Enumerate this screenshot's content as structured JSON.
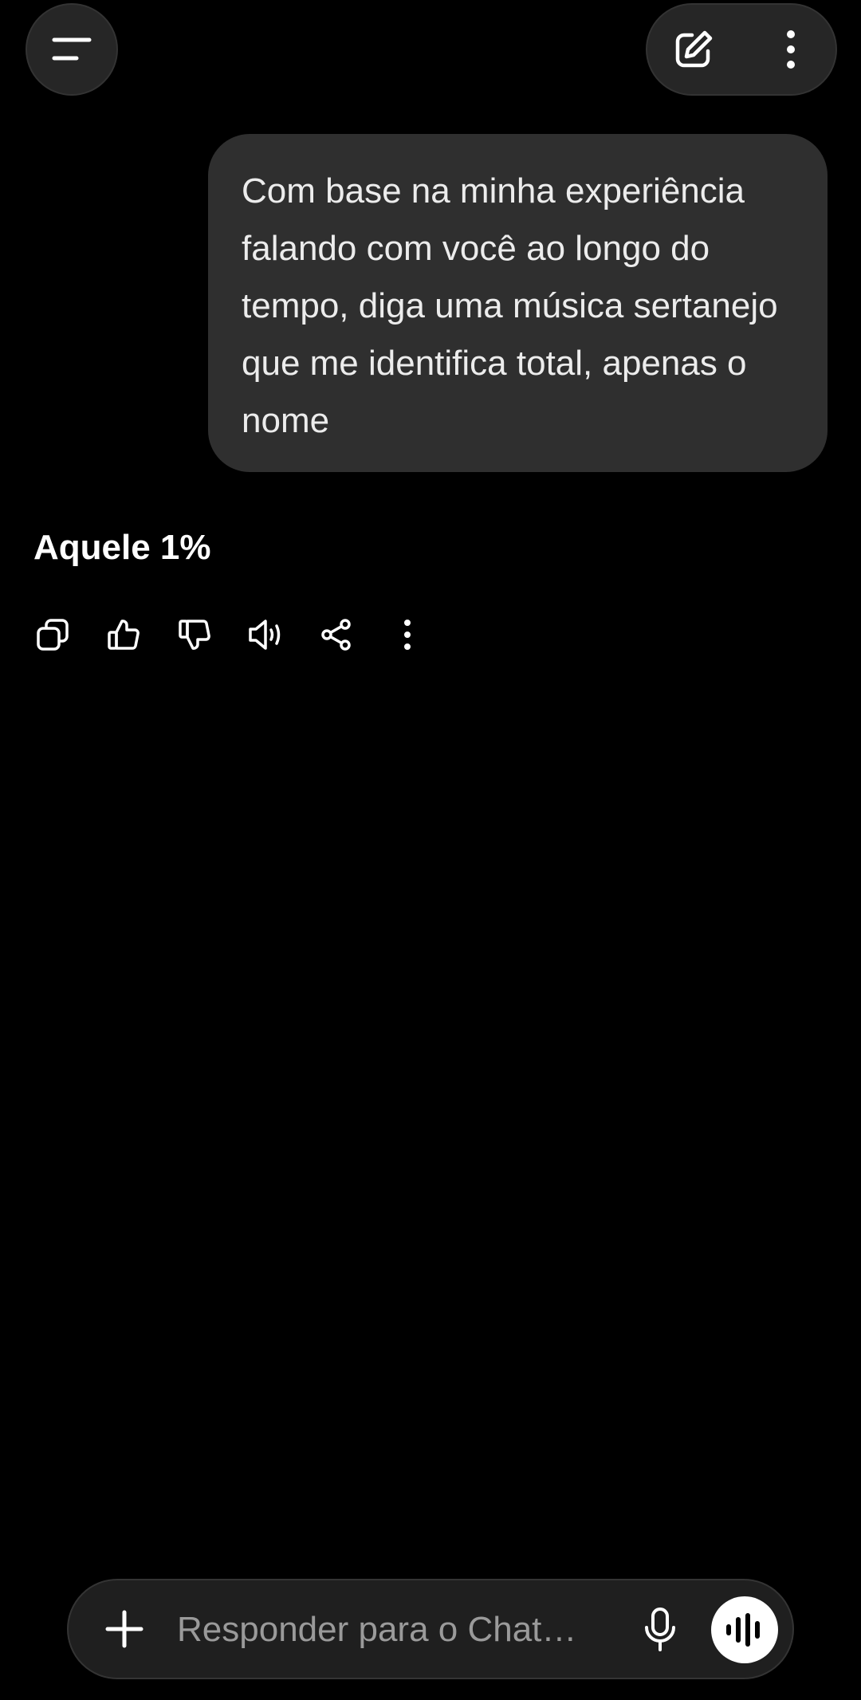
{
  "header": {
    "menu_icon": "menu-icon",
    "new_chat_icon": "edit-icon",
    "more_icon": "more-vertical-icon"
  },
  "conversation": {
    "user_message": "Com base na minha experiência falando com você ao longo do tempo, diga uma música sertanejo que me identifica total, apenas o nome",
    "assistant_message": "Aquele 1%",
    "actions": [
      "copy-icon",
      "thumbs-up-icon",
      "thumbs-down-icon",
      "speaker-icon",
      "share-icon",
      "more-vertical-icon"
    ]
  },
  "composer": {
    "placeholder": "Responder para o Chat…",
    "value": "",
    "plus_icon": "plus-icon",
    "mic_icon": "microphone-icon",
    "voice_icon": "voice-waveform-icon"
  },
  "colors": {
    "background": "#000000",
    "bubble": "#2f2f2f",
    "control": "#262626",
    "text": "#ffffff",
    "placeholder": "#9a9a9a"
  }
}
